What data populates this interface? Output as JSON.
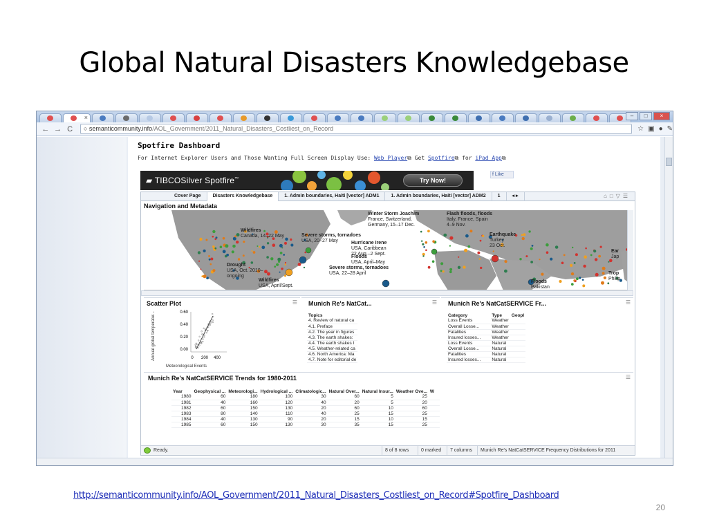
{
  "slide": {
    "title": "Global Natural Disasters Knowledgebase",
    "link": "http://semanticommunity.info/AOL_Government/2011_Natural_Disasters_Costliest_on_Record#Spotfire_Dashboard",
    "number": "20"
  },
  "browser": {
    "url_host": "semanticommunity.info",
    "url_path": "/AOL_Government/2011_Natural_Disasters_Costliest_on_Record",
    "tab_close": "×",
    "tab_favicon_colors": [
      "#e05050",
      "#e05050",
      "#4a7bc0",
      "#6b6b6b",
      "#b6c9e4",
      "#e05050",
      "#d94040",
      "#e05050",
      "#e89a2a",
      "#333333",
      "#3a9ad9",
      "#e05050",
      "#4a7bc0",
      "#4a7bc0",
      "#9bd07a",
      "#9bd07a",
      "#3a8a3a",
      "#3a8a3a",
      "#3f6fb0",
      "#4a7bc0",
      "#3f6fb0",
      "#9ab0d0",
      "#6cae4a",
      "#e05050",
      "#e05050"
    ]
  },
  "page": {
    "heading": "Spotfire Dashboard",
    "intro": "For Internet Explorer Users and Those Wanting Full Screen Display Use:",
    "link_webplayer": "Web Player",
    "get": "Get",
    "link_spotfire": "Spotfire",
    "for": "for",
    "link_ipad": "iPad App",
    "banner_brand": "TIBCOSilver Spotfire",
    "banner_tm": "™",
    "try_now": "Try Now!",
    "fb_like": "Like"
  },
  "spotfire": {
    "tabs": [
      "Cover Page",
      "Disasters Knowledgebase",
      "1. Admin boundaries, Haiti [vector] ADM1",
      "1. Admin boundaries, Haiti [vector] ADM2",
      "1"
    ],
    "active_tab": 1,
    "map_title": "Navigation and Metadata",
    "map_labels": [
      {
        "title": "Winter Storm Joachim",
        "body": "France, Switzerland,\nGermany, 15–17 Dec."
      },
      {
        "title": "Flash floods, floods",
        "body": "Italy, France, Spain\n4–9 Nov."
      },
      {
        "title": "Wildfires",
        "body": "Canada, 14–22 May"
      },
      {
        "title": "Severe storms, tornadoes",
        "body": "USA, 20–27 May"
      },
      {
        "title": "Hurricane Irene",
        "body": "USA, Caribbean\n22 Aug.–2 Sept."
      },
      {
        "title": "Earthquake",
        "body": "Turkey\n23 Oct."
      },
      {
        "title": "Floods",
        "body": "USA, April–May"
      },
      {
        "title": "Drought",
        "body": "USA, Oct. 2010–\nongoing"
      },
      {
        "title": "Severe storms, tornadoes",
        "body": "USA, 22–28 April"
      },
      {
        "title": "Wildfires",
        "body": "USA, April/Sept."
      },
      {
        "title": "Floods",
        "body": "Pakistan\nAug.–Sept."
      },
      {
        "title": "Ear",
        "body": "Jap"
      },
      {
        "title": "Trop",
        "body": "Philip"
      }
    ],
    "scatter": {
      "title": "Scatter Plot",
      "ylabel": "Annual global temperatur...",
      "xlabel": "Meteorological Events",
      "yticks": [
        "0.60",
        "0.40",
        "0.20",
        "0.00"
      ],
      "xticks": [
        "0",
        "200",
        "400"
      ]
    },
    "natcat_topics": {
      "title": "Munich Re's NatCat...",
      "header": "Topics",
      "rows": [
        "4. Review of natural ca",
        "4.1. Preface",
        "4.2. The year in figures",
        "4.3. The earth shakes:",
        "4.4. The earth shakes I",
        "4.5. Weather-related ca",
        "4.6. North America: Ma",
        "4.7. Note for editorial de"
      ]
    },
    "natcat_freq": {
      "title": "Munich Re's NatCatSERVICE Fr...",
      "headers": [
        "Category",
        "Type",
        "Geopl"
      ],
      "rows": [
        [
          "Loss Events",
          "Weather",
          ""
        ],
        [
          "Overall Losse...",
          "Weather",
          ""
        ],
        [
          "Fatalities",
          "Weather",
          ""
        ],
        [
          "Insured losses...",
          "Weather",
          ""
        ],
        [
          "Loss Events",
          "Natural",
          ""
        ],
        [
          "Overall Losse...",
          "Natural",
          ""
        ],
        [
          "Fatalities",
          "Natural",
          ""
        ],
        [
          "Insured losses...",
          "Natural",
          ""
        ]
      ]
    },
    "trends": {
      "title": "Munich Re's NatCatSERVICE Trends for 1980-2011",
      "headers": [
        "Year",
        "Geophysical ...",
        "Meteorologi...",
        "Hydrological ...",
        "Climatologic...",
        "Natural Over...",
        "Natural Insur...",
        "Weather Ove...",
        "W"
      ],
      "rows": [
        [
          "1980",
          "60",
          "180",
          "100",
          "30",
          "60",
          "5",
          "25",
          ""
        ],
        [
          "1981",
          "40",
          "160",
          "120",
          "40",
          "20",
          "5",
          "20",
          ""
        ],
        [
          "1982",
          "60",
          "150",
          "130",
          "20",
          "60",
          "10",
          "60",
          ""
        ],
        [
          "1983",
          "80",
          "140",
          "110",
          "40",
          "25",
          "15",
          "25",
          ""
        ],
        [
          "1984",
          "40",
          "130",
          "90",
          "20",
          "15",
          "10",
          "15",
          ""
        ],
        [
          "1985",
          "60",
          "150",
          "130",
          "30",
          "35",
          "15",
          "25",
          ""
        ]
      ]
    },
    "status": {
      "ready": "Ready.",
      "rows": "8 of 8 rows",
      "marked": "0 marked",
      "columns": "7 columns",
      "table": "Munich Re's NatCatSERVICE Frequency Distributions for 2011"
    }
  }
}
